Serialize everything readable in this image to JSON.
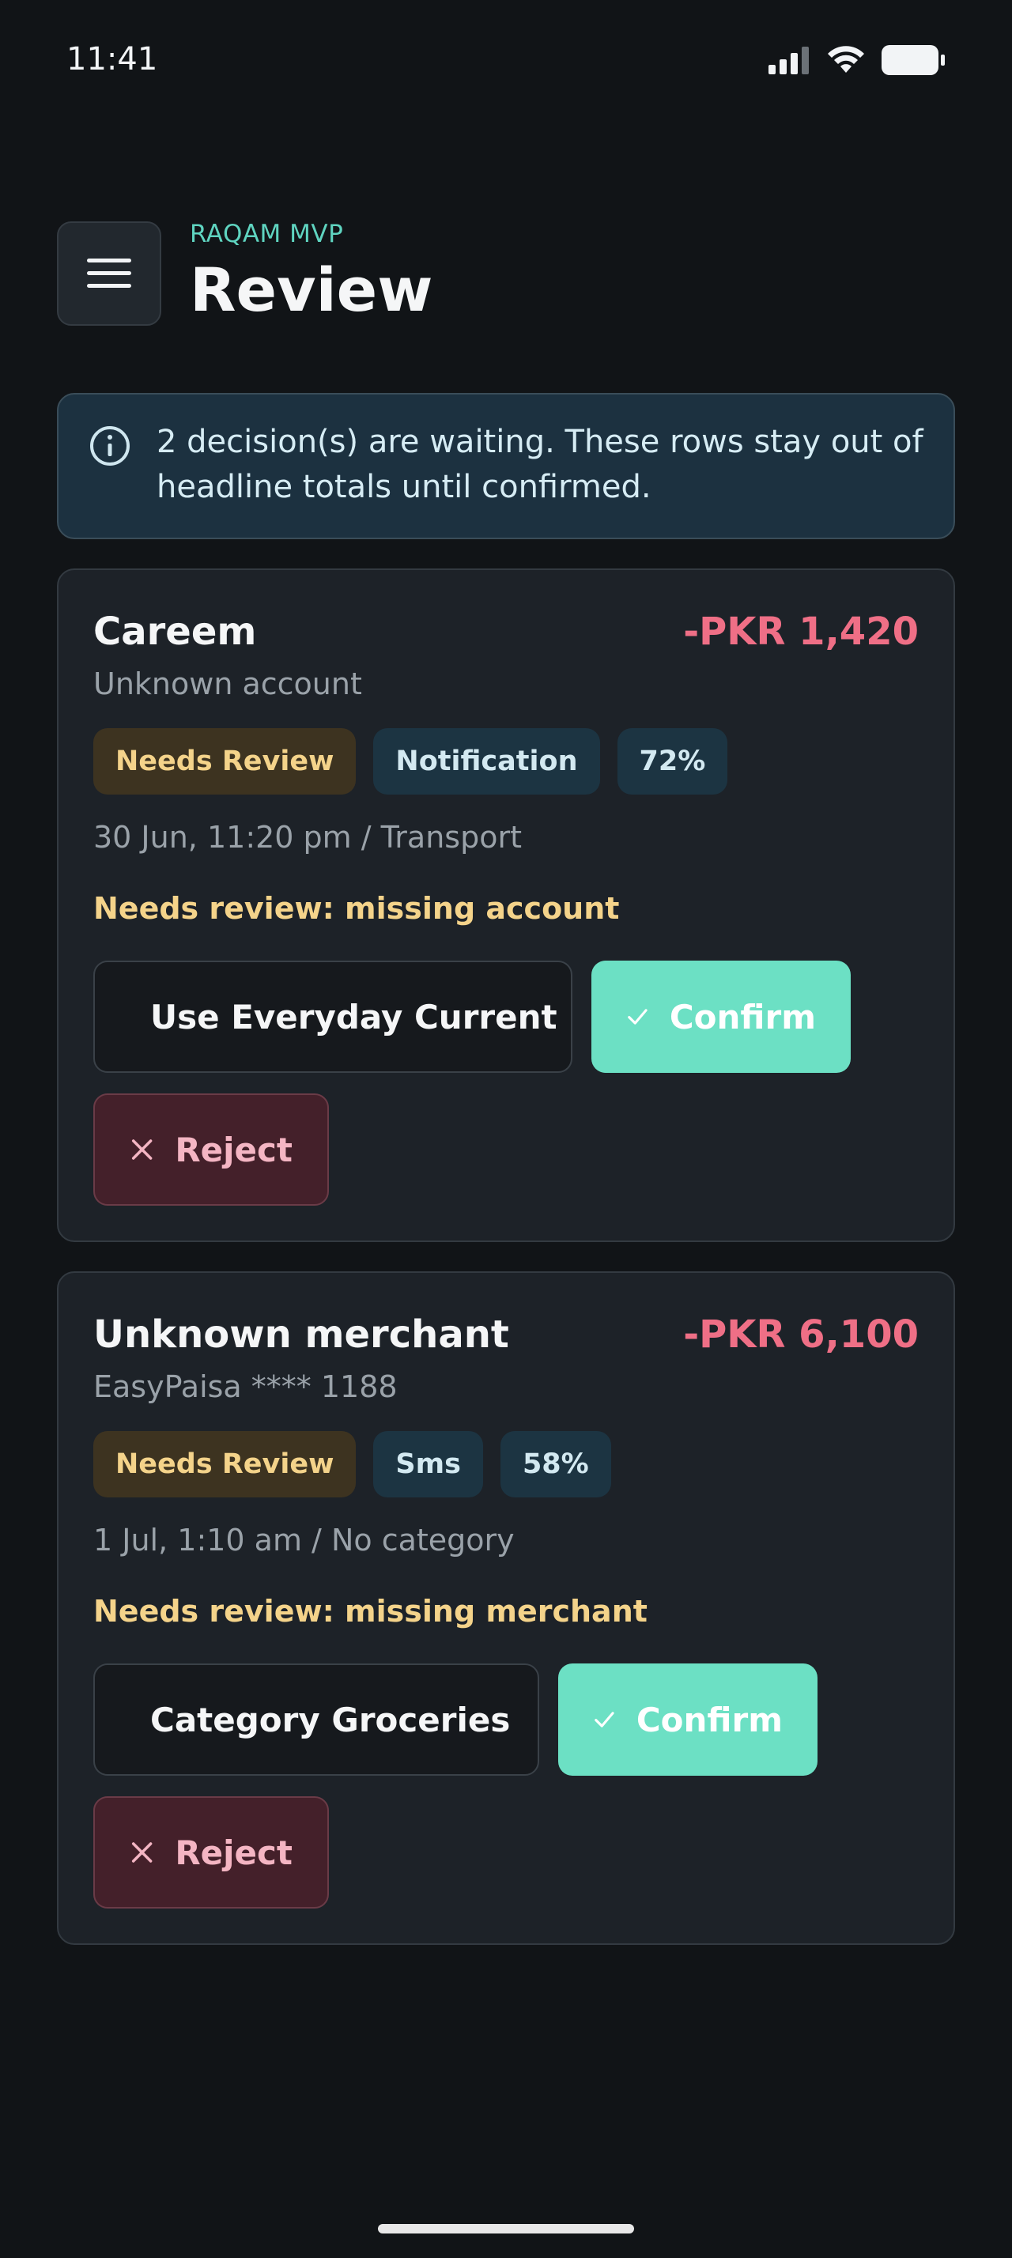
{
  "status_bar": {
    "time": "11:41"
  },
  "header": {
    "eyebrow": "RAQAM MVP",
    "title": "Review"
  },
  "banner": {
    "text": "2 decision(s) are waiting. These rows stay out of headline totals until confirmed."
  },
  "cards": [
    {
      "merchant": "Careem",
      "amount": "-PKR 1,420",
      "account": "Unknown account",
      "chips": [
        "Needs Review",
        "Notification",
        "72%"
      ],
      "meta": "30 Jun, 11:20 pm / Transport",
      "reason": "Needs review: missing account",
      "suggest_label": "Use Everyday Current",
      "suggest_icon": "bank-icon",
      "confirm_label": "Confirm",
      "reject_label": "Reject"
    },
    {
      "merchant": "Unknown merchant",
      "amount": "-PKR 6,100",
      "account": "EasyPaisa **** 1188",
      "chips": [
        "Needs Review",
        "Sms",
        "58%"
      ],
      "meta": "1 Jul, 1:10 am / No category",
      "reason": "Needs review: missing merchant",
      "suggest_label": "Category Groceries",
      "suggest_icon": "tag-plus-icon",
      "confirm_label": "Confirm",
      "reject_label": "Reject"
    }
  ],
  "colors": {
    "background": "#111417",
    "accent": "#6ce0c4",
    "negative_amount": "#ef6f86",
    "warning": "#f4d38a"
  }
}
